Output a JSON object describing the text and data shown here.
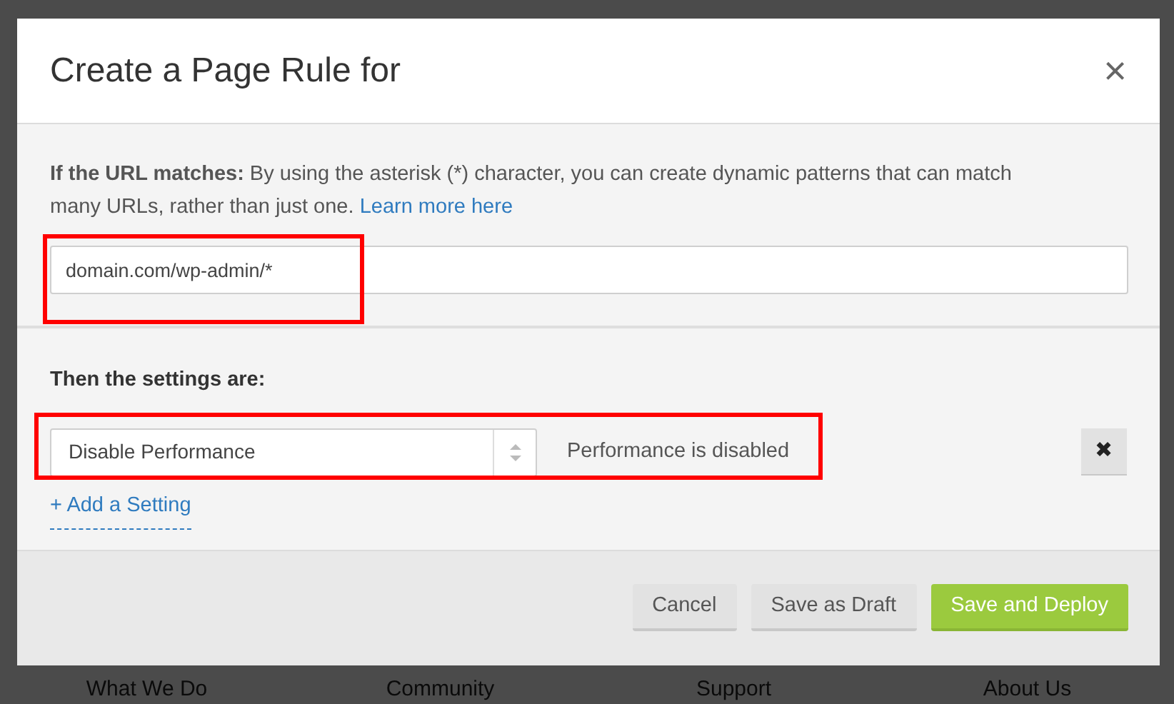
{
  "dialog": {
    "title": "Create a Page Rule for",
    "close": "×"
  },
  "url_section": {
    "text": "**If the URL matches:** By using the asterisk (*) character, you can create dynamic patterns that can match many URLs, rather than just one.",
    "link": "Learn more here",
    "value": "domain.com/wp-admin/*"
  },
  "settings_section": {
    "heading": "Then the settings are:",
    "settings": [
      {
        "value": "Disable Performance",
        "description": "Performance is disabled",
        "remove": "✖"
      }
    ],
    "add": "+ Add a Setting"
  },
  "buttons": [
    {
      "label": "Cancel",
      "kind": "secondary"
    },
    {
      "label": "Save as Draft",
      "kind": "secondary"
    },
    {
      "label": "Save and Deploy",
      "kind": "primary"
    }
  ],
  "footer_links": [
    "What We Do",
    "Community",
    "Support",
    "About Us"
  ]
}
